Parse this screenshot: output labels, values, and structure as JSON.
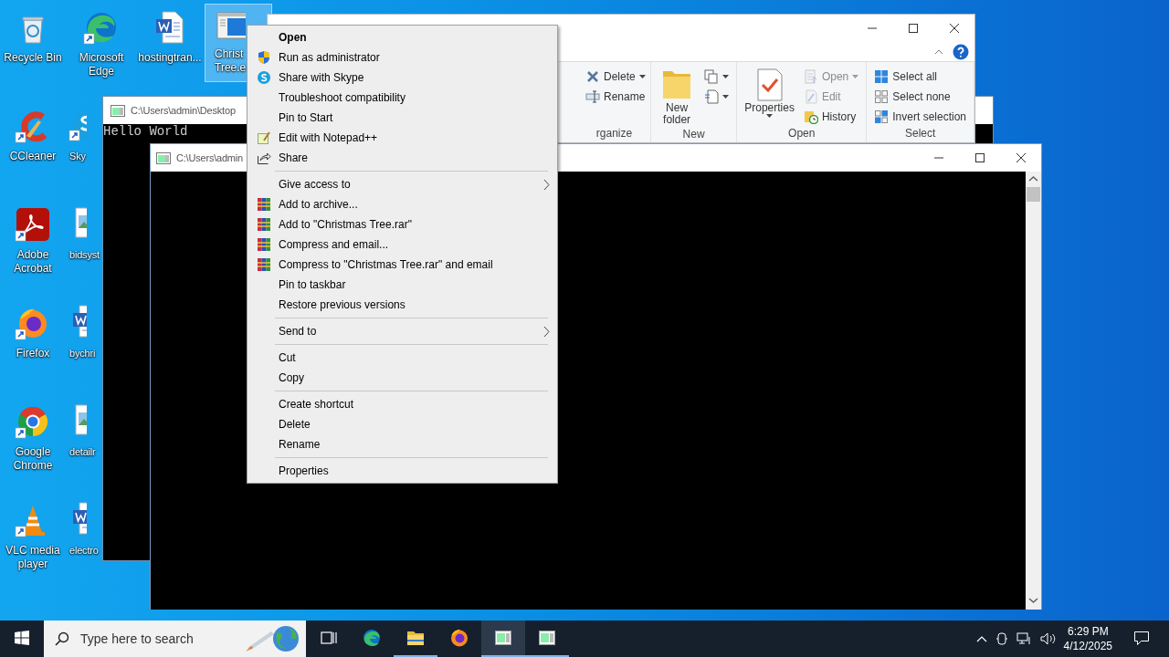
{
  "desktop": {
    "rows": [
      [
        {
          "label": "Recycle Bin",
          "kind": "recycle",
          "shortcut": false,
          "selected": false
        },
        {
          "label": "Microsoft Edge",
          "kind": "edge",
          "shortcut": true,
          "selected": false
        },
        {
          "label": "hostingtran...",
          "kind": "word",
          "shortcut": false,
          "selected": false
        },
        {
          "label": "Christ Tree.e",
          "kind": "exe",
          "shortcut": false,
          "selected": true
        }
      ],
      [
        {
          "label": "CCleaner",
          "kind": "ccleaner",
          "shortcut": true,
          "selected": false
        },
        {
          "label": "Sky",
          "kind": "skype",
          "shortcut": true,
          "selected": false
        }
      ],
      [
        {
          "label": "Adobe Acrobat",
          "kind": "acrobat",
          "shortcut": true,
          "selected": false
        },
        {
          "label": "bidsyst",
          "kind": "image",
          "shortcut": false,
          "selected": false
        }
      ],
      [
        {
          "label": "Firefox",
          "kind": "firefox",
          "shortcut": true,
          "selected": false
        },
        {
          "label": "bychri",
          "kind": "word",
          "shortcut": false,
          "selected": false
        }
      ],
      [
        {
          "label": "Google Chrome",
          "kind": "chrome",
          "shortcut": true,
          "selected": false
        },
        {
          "label": "detailr",
          "kind": "image",
          "shortcut": false,
          "selected": false
        }
      ],
      [
        {
          "label": "VLC media player",
          "kind": "vlc",
          "shortcut": true,
          "selected": false
        },
        {
          "label": "electro",
          "kind": "word",
          "shortcut": false,
          "selected": false
        }
      ]
    ]
  },
  "console_back": {
    "title": "C:\\Users\\admin\\Desktop",
    "output": "Hello World"
  },
  "explorer": {
    "ribbon_groups": [
      {
        "label": "rganize",
        "items": [
          {
            "kind": "delete",
            "label": "Delete",
            "dropdown": true,
            "disabled": false
          },
          {
            "kind": "rename",
            "label": "Rename",
            "dropdown": false,
            "disabled": false
          }
        ]
      },
      {
        "label": "New",
        "items": [
          {
            "kind": "folder",
            "label": "New folder",
            "dropdown": false
          },
          {
            "kind": "newitem",
            "dropdown": true,
            "disabled": false
          },
          {
            "kind": "easyaccess",
            "dropdown": true,
            "disabled": false
          }
        ]
      },
      {
        "label": "Open",
        "items": [
          {
            "kind": "properties",
            "label": "Properties",
            "dropdown": true
          },
          {
            "kind": "open",
            "label": "Open",
            "dropdown": true,
            "disabled": true
          },
          {
            "kind": "edit",
            "label": "Edit",
            "dropdown": false,
            "disabled": true
          },
          {
            "kind": "history",
            "label": "History",
            "dropdown": false,
            "disabled": false
          }
        ]
      },
      {
        "label": "Select",
        "items": [
          {
            "kind": "selectall",
            "label": "Select all",
            "dropdown": false,
            "disabled": false
          },
          {
            "kind": "selectnone",
            "label": "Select none",
            "dropdown": false,
            "disabled": false
          },
          {
            "kind": "invert",
            "label": "Invert selection",
            "dropdown": false,
            "disabled": false
          }
        ]
      }
    ]
  },
  "console_front": {
    "title": "C:\\Users\\admin"
  },
  "context_menu": {
    "items": [
      {
        "kind": "item",
        "label": "Open",
        "default": true,
        "submenu": false
      },
      {
        "kind": "shield",
        "label": "Run as administrator",
        "default": false,
        "submenu": false
      },
      {
        "kind": "skype",
        "label": "Share with Skype",
        "default": false,
        "submenu": false
      },
      {
        "kind": "item",
        "label": "Troubleshoot compatibility",
        "default": false,
        "submenu": false
      },
      {
        "kind": "item",
        "label": "Pin to Start",
        "default": false,
        "submenu": false
      },
      {
        "kind": "notepad",
        "label": "Edit with Notepad++",
        "default": false,
        "submenu": false
      },
      {
        "kind": "share",
        "label": "Share",
        "default": false,
        "submenu": false
      },
      {
        "kind": "separator"
      },
      {
        "kind": "item",
        "label": "Give access to",
        "default": false,
        "submenu": true
      },
      {
        "kind": "archive",
        "label": "Add to archive...",
        "default": false,
        "submenu": false
      },
      {
        "kind": "archive",
        "label": "Add to \"Christmas Tree.rar\"",
        "default": false,
        "submenu": false
      },
      {
        "kind": "archive",
        "label": "Compress and email...",
        "default": false,
        "submenu": false
      },
      {
        "kind": "archive",
        "label": "Compress to \"Christmas Tree.rar\" and email",
        "default": false,
        "submenu": false
      },
      {
        "kind": "item",
        "label": "Pin to taskbar",
        "default": false,
        "submenu": false
      },
      {
        "kind": "item",
        "label": "Restore previous versions",
        "default": false,
        "submenu": false
      },
      {
        "kind": "separator"
      },
      {
        "kind": "item",
        "label": "Send to",
        "default": false,
        "submenu": true
      },
      {
        "kind": "separator"
      },
      {
        "kind": "item",
        "label": "Cut",
        "default": false,
        "submenu": false
      },
      {
        "kind": "item",
        "label": "Copy",
        "default": false,
        "submenu": false
      },
      {
        "kind": "separator"
      },
      {
        "kind": "item",
        "label": "Create shortcut",
        "default": false,
        "submenu": false
      },
      {
        "kind": "item",
        "label": "Delete",
        "default": false,
        "submenu": false
      },
      {
        "kind": "item",
        "label": "Rename",
        "default": false,
        "submenu": false
      },
      {
        "kind": "separator"
      },
      {
        "kind": "item",
        "label": "Properties",
        "default": false,
        "submenu": false
      }
    ]
  },
  "taskbar": {
    "search": {
      "placeholder": "Type here to search"
    },
    "apps": [
      {
        "kind": "taskview",
        "running": false,
        "selected": false
      },
      {
        "kind": "edge",
        "running": false,
        "selected": false
      },
      {
        "kind": "folder",
        "running": true,
        "selected": false
      },
      {
        "kind": "firefox",
        "running": false,
        "selected": false
      },
      {
        "kind": "console",
        "running": true,
        "selected": true
      },
      {
        "kind": "console",
        "running": true,
        "selected": false
      }
    ],
    "clock": {
      "time": "6:29 PM",
      "date": "4/12/2025"
    }
  }
}
